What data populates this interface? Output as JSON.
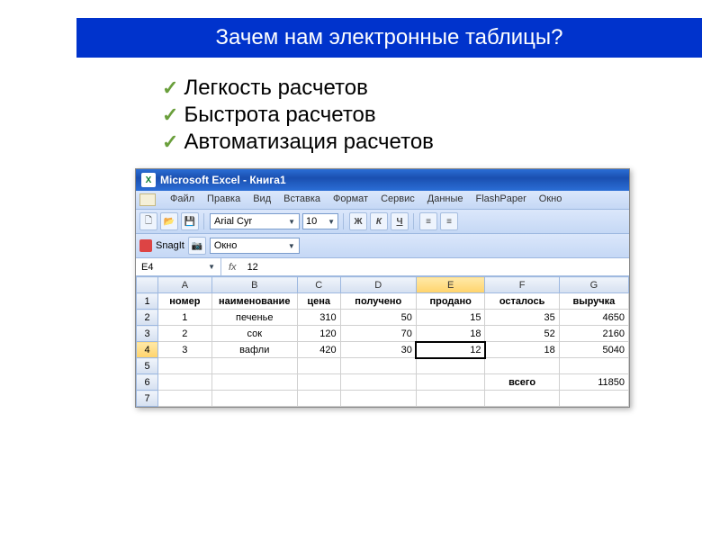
{
  "slide": {
    "title": "Зачем нам электронные таблицы?",
    "bullets": [
      "Легкость расчетов",
      "Быстрота расчетов",
      "Автоматизация расчетов"
    ]
  },
  "excel": {
    "window_title": "Microsoft Excel - Книга1",
    "menu": [
      "Файл",
      "Правка",
      "Вид",
      "Вставка",
      "Формат",
      "Сервис",
      "Данные",
      "FlashPaper",
      "Окно"
    ],
    "toolbar": {
      "font": "Arial Cyr",
      "size": "10",
      "bold": "Ж",
      "italic": "К",
      "underline": "Ч"
    },
    "snagit": {
      "label": "SnagIt",
      "window_label": "Окно"
    },
    "formula_bar": {
      "cell_ref": "E4",
      "fx": "fx",
      "value": "12"
    },
    "columns": [
      "A",
      "B",
      "C",
      "D",
      "E",
      "F",
      "G"
    ],
    "selected_col": "E",
    "selected_row": "4",
    "rows": [
      {
        "n": "1",
        "cells": [
          "номер",
          "наименование",
          "цена",
          "получено",
          "продано",
          "осталось",
          "выручка"
        ],
        "bold": true
      },
      {
        "n": "2",
        "cells": [
          "1",
          "печенье",
          "310",
          "50",
          "15",
          "35",
          "4650"
        ]
      },
      {
        "n": "3",
        "cells": [
          "2",
          "сок",
          "120",
          "70",
          "18",
          "52",
          "2160"
        ]
      },
      {
        "n": "4",
        "cells": [
          "3",
          "вафли",
          "420",
          "30",
          "12",
          "18",
          "5040"
        ]
      },
      {
        "n": "5",
        "cells": [
          "",
          "",
          "",
          "",
          "",
          "",
          ""
        ]
      },
      {
        "n": "6",
        "cells": [
          "",
          "",
          "",
          "",
          "",
          "всего",
          "11850"
        ]
      },
      {
        "n": "7",
        "cells": [
          "",
          "",
          "",
          "",
          "",
          "",
          ""
        ]
      }
    ]
  }
}
